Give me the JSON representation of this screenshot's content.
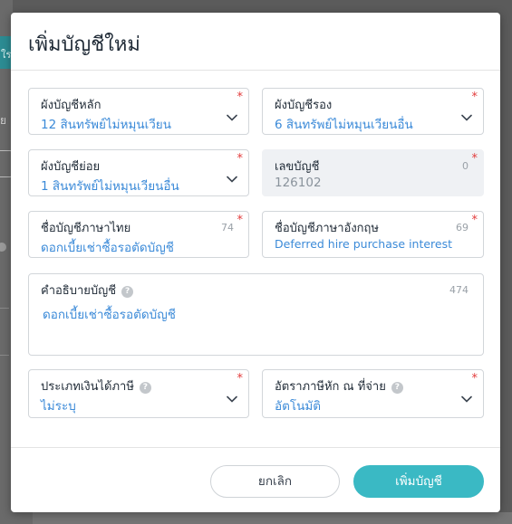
{
  "background": {
    "tab_text": "ใร",
    "side_letter": "ย"
  },
  "dialog": {
    "title": "เพิ่มบัญชีใหม่"
  },
  "form": {
    "main_chart": {
      "label": "ผังบัญชีหลัก",
      "value": "12 สินทรัพย์ไม่หมุนเวียน",
      "required": "*"
    },
    "sub_chart": {
      "label": "ผังบัญชีรอง",
      "value": "6 สินทรัพย์ไม่หมุนเวียนอื่น",
      "required": "*"
    },
    "minor_chart": {
      "label": "ผังบัญชีย่อย",
      "value": "1 สินทรัพย์ไม่หมุนเวียนอื่น",
      "required": "*"
    },
    "account_number": {
      "label": "เลขบัญชี",
      "value": "126102",
      "counter": "0",
      "required": "*"
    },
    "thai_name": {
      "label": "ชื่อบัญชีภาษาไทย",
      "value": "ดอกเบี้ยเช่าซื้อรอตัดบัญชี",
      "counter": "74",
      "required": "*"
    },
    "english_name": {
      "label": "ชื่อบัญชีภาษาอังกฤษ",
      "value": "Deferred hire purchase interest",
      "counter": "69",
      "required": "*"
    },
    "description": {
      "label": "คำอธิบายบัญชี",
      "value": "ดอกเบี้ยเช่าซื้อรอตัดบัญชี",
      "counter": "474",
      "help": "?"
    },
    "income_type": {
      "label": "ประเภทเงินได้ภาษี",
      "value": "ไม่ระบุ",
      "required": "*",
      "help": "?"
    },
    "withholding_rate": {
      "label": "อัตราภาษีหัก ณ ที่จ่าย",
      "value": "อัตโนมัติ",
      "required": "*",
      "help": "?"
    }
  },
  "footer": {
    "cancel_label": "ยกเลิก",
    "add_label": "เพิ่มบัญชี"
  },
  "colors": {
    "accent": "#3ab9c4",
    "value_text": "#3b8ad8",
    "required": "#e23b3b"
  }
}
